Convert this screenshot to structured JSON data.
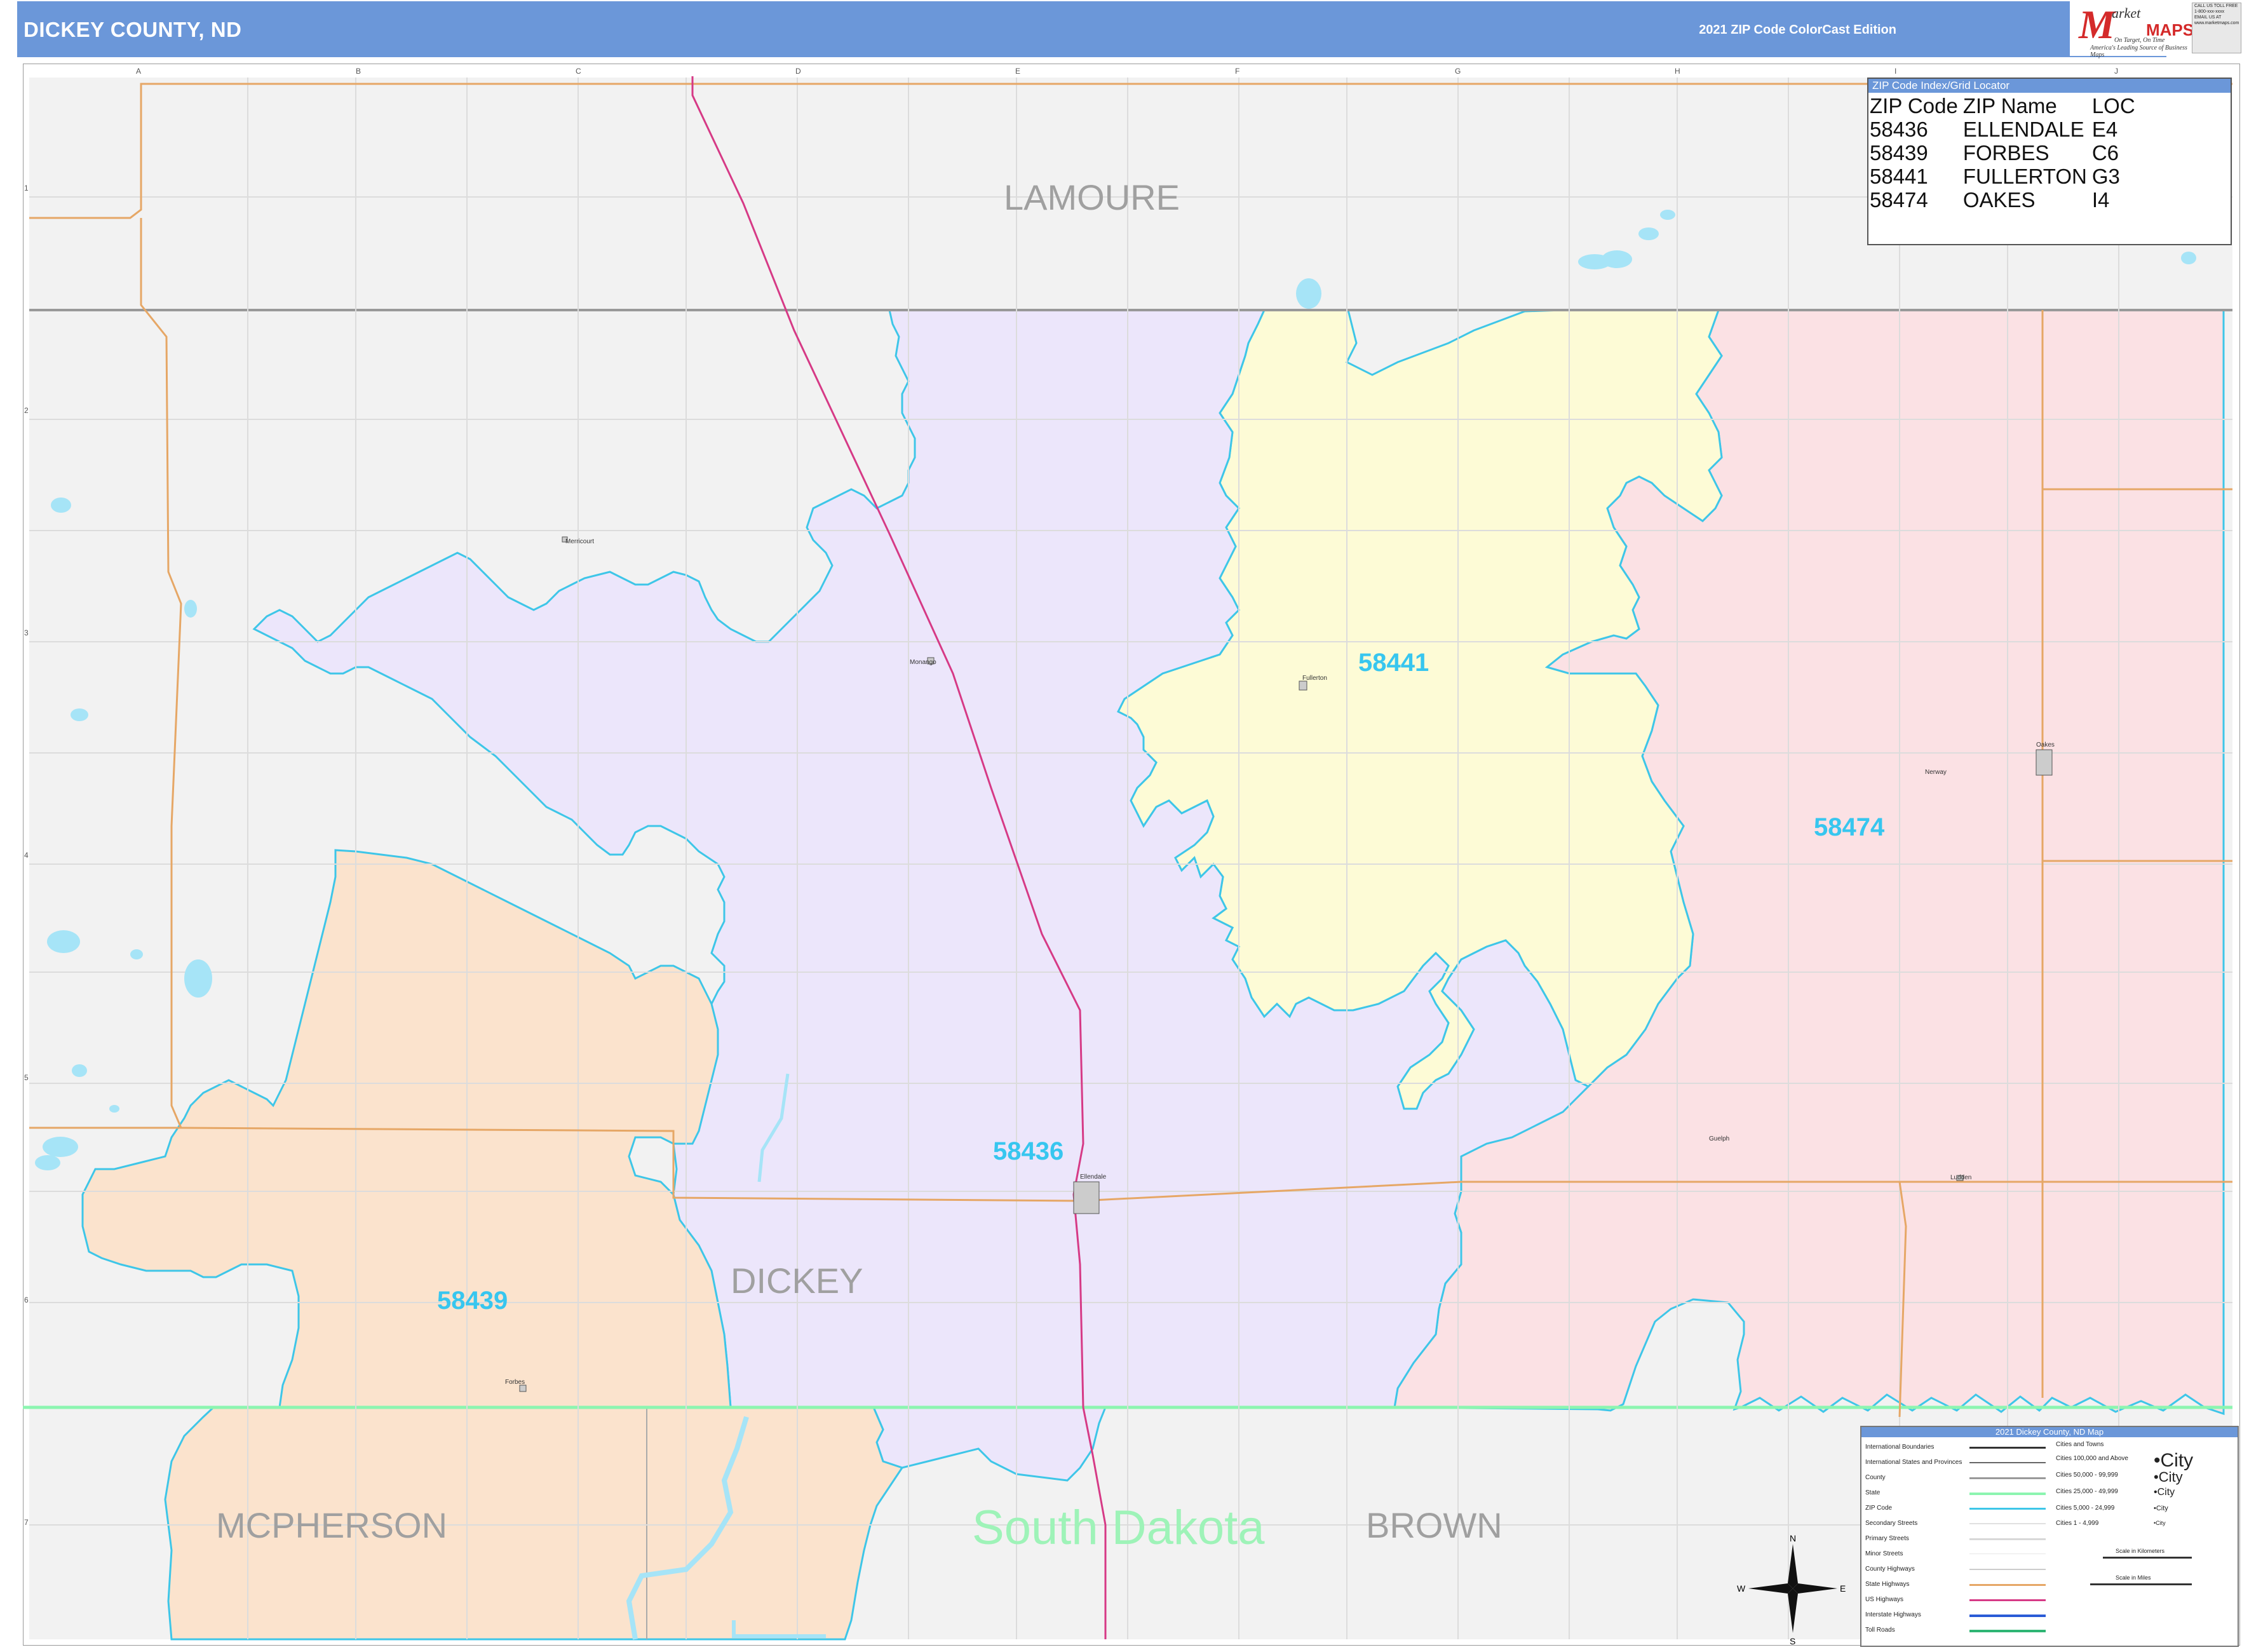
{
  "header": {
    "title": "DICKEY COUNTY, ND",
    "edition": "2021 ZIP Code ColorCast Edition"
  },
  "logo": {
    "brand_m": "M",
    "brand_market": "arket",
    "brand_maps": "MAPS",
    "tagline1": "On Target, On Time",
    "tagline2": "America's Leading Source of Business Maps"
  },
  "contact": {
    "lines": [
      "CALL US TOLL FREE",
      "1-800-xxx-xxxx",
      "EMAIL US AT",
      "www.marketmaps.com"
    ]
  },
  "zip_index": {
    "heading": "ZIP Code Index/Grid Locator",
    "columns": [
      "ZIP Code",
      "ZIP Name",
      "LOC"
    ],
    "rows": [
      [
        "58436",
        "ELLENDALE",
        "E4"
      ],
      [
        "58439",
        "FORBES",
        "C6"
      ],
      [
        "58441",
        "FULLERTON",
        "G3"
      ],
      [
        "58474",
        "OAKES",
        "I4"
      ]
    ]
  },
  "map": {
    "zip_labels": [
      "58441",
      "58474",
      "58436",
      "58439"
    ],
    "county_labels": [
      "LAMOURE",
      "DICKEY",
      "MCPHERSON",
      "BROWN"
    ],
    "state_label": "South Dakota",
    "towns": [
      "Fullerton",
      "Oakes",
      "Ellendale",
      "Monango",
      "Forbes",
      "Guelph",
      "Ludden",
      "Merricourt",
      "Nerway"
    ],
    "grid_columns": [
      "A",
      "B",
      "C",
      "D",
      "E",
      "F",
      "G",
      "H",
      "I",
      "J"
    ],
    "grid_rows": [
      "1",
      "2",
      "3",
      "4",
      "5",
      "6",
      "7"
    ],
    "compass": [
      "N",
      "S",
      "E",
      "W"
    ],
    "colors": {
      "z58441": "#fdfbd6",
      "z58474": "#fbe1e4",
      "z58436": "#ece6fb",
      "z58439": "#fbe3cd",
      "outside": "#f2f2f2",
      "zip_boundary": "#3ec6e8",
      "state_boundary": "#8cf5b0",
      "us_highway": "#d63a86",
      "state_highway": "#e6a766",
      "water": "#a6e4f7",
      "header": "#6b97d9"
    }
  },
  "legend": {
    "title": "2021 Dickey County, ND Map",
    "line_items": [
      "International Boundaries",
      "International States and Provinces",
      "County",
      "State",
      "ZIP Code",
      "Secondary Streets",
      "Primary Streets",
      "Minor Streets",
      "County Highways",
      "State Highways",
      "US Highways",
      "Interstate Highways",
      "Toll Roads"
    ],
    "city_items": [
      [
        "Cities and Towns",
        ""
      ],
      [
        "Cities 100,000 and Above",
        "•City"
      ],
      [
        "Cities 50,000 - 99,999",
        "•City"
      ],
      [
        "Cities 25,000 - 49,999",
        "•City"
      ],
      [
        "Cities 5,000 - 24,999",
        "•City"
      ],
      [
        "Cities 1 - 4,999",
        "•City"
      ]
    ],
    "scale_km": "Scale in Kilometers",
    "scale_mi": "Scale in Miles"
  }
}
